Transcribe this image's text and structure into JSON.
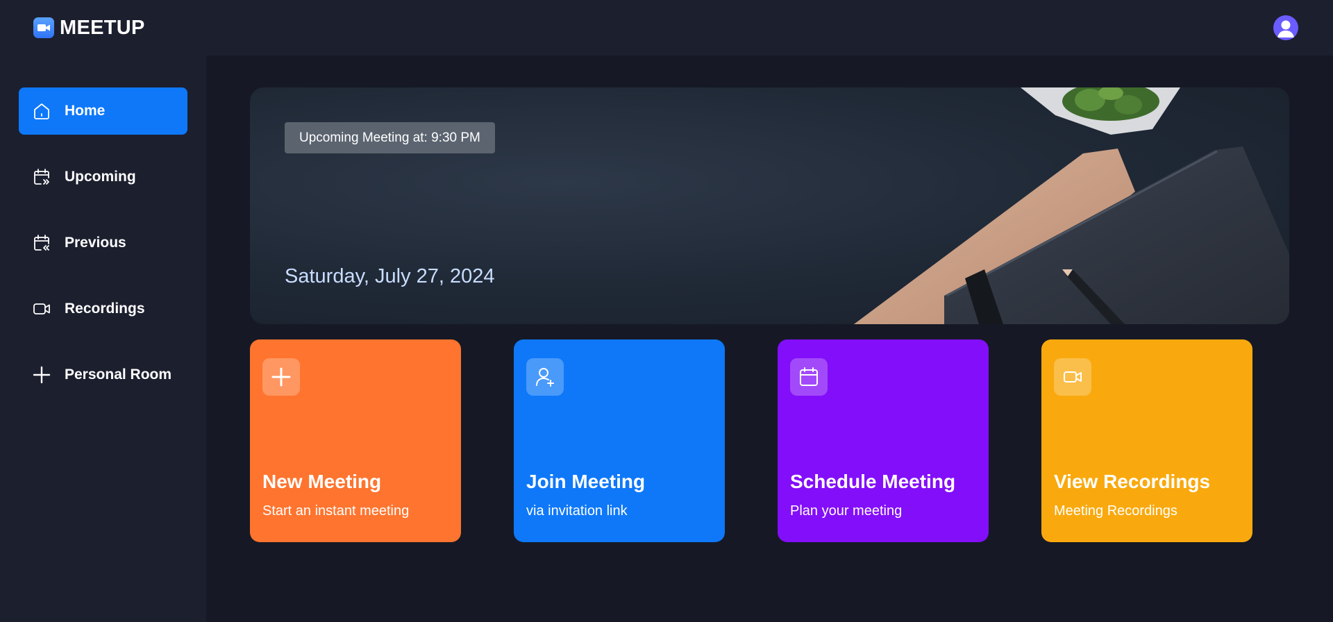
{
  "app": {
    "name": "MEETUP"
  },
  "sidebar": {
    "items": [
      {
        "label": "Home",
        "icon": "home-icon",
        "active": true
      },
      {
        "label": "Upcoming",
        "icon": "calendar-upcoming-icon",
        "active": false
      },
      {
        "label": "Previous",
        "icon": "calendar-previous-icon",
        "active": false
      },
      {
        "label": "Recordings",
        "icon": "video-icon",
        "active": false
      },
      {
        "label": "Personal Room",
        "icon": "plus-icon",
        "active": false
      }
    ]
  },
  "hero": {
    "badge": "Upcoming Meeting at: 9:30 PM",
    "date": "Saturday, July 27, 2024"
  },
  "cards": [
    {
      "title": "New Meeting",
      "subtitle": "Start an instant meeting",
      "icon": "plus-icon",
      "color": "#ff742e"
    },
    {
      "title": "Join Meeting",
      "subtitle": "via invitation link",
      "icon": "add-user-icon",
      "color": "#0e78f9"
    },
    {
      "title": "Schedule Meeting",
      "subtitle": "Plan your meeting",
      "icon": "calendar-icon",
      "color": "#830ef9"
    },
    {
      "title": "View Recordings",
      "subtitle": "Meeting Recordings",
      "icon": "video-icon",
      "color": "#f9a90e"
    }
  ],
  "colors": {
    "background": "#161925",
    "panel": "#1c1f2e",
    "accent": "#0e78f9"
  }
}
